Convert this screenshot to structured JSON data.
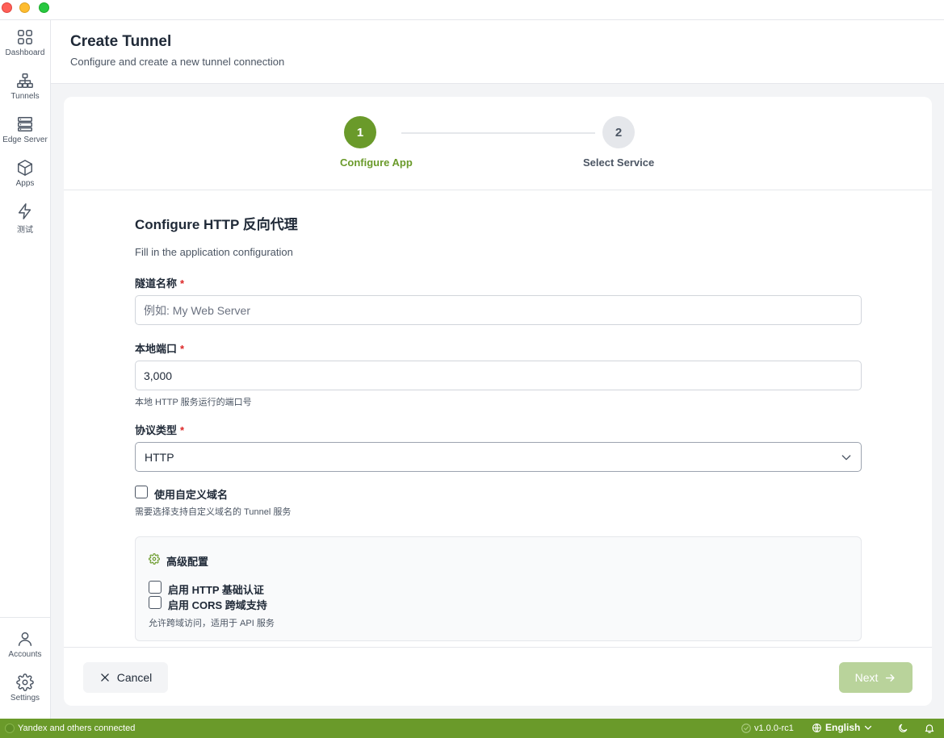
{
  "sidebar": {
    "items": [
      {
        "label": "Dashboard",
        "icon": "grid-icon"
      },
      {
        "label": "Tunnels",
        "icon": "network-icon"
      },
      {
        "label": "Edge Server",
        "icon": "server-icon"
      },
      {
        "label": "Apps",
        "icon": "cube-icon"
      },
      {
        "label": "测试",
        "icon": "bolt-icon"
      }
    ],
    "bottom": [
      {
        "label": "Accounts",
        "icon": "user-icon"
      },
      {
        "label": "Settings",
        "icon": "gear-icon"
      }
    ]
  },
  "header": {
    "title": "Create Tunnel",
    "subtitle": "Configure and create a new tunnel connection"
  },
  "stepper": {
    "steps": [
      {
        "number": "1",
        "label": "Configure App",
        "state": "active"
      },
      {
        "number": "2",
        "label": "Select Service",
        "state": "pending"
      }
    ]
  },
  "form": {
    "title": "Configure HTTP 反向代理",
    "description": "Fill in the application configuration",
    "tunnel_name": {
      "label": "隧道名称",
      "required": "*",
      "placeholder": "例如: My Web Server",
      "value": ""
    },
    "local_port": {
      "label": "本地端口",
      "required": "*",
      "value": "3,000",
      "hint": "本地 HTTP 服务运行的端口号"
    },
    "protocol": {
      "label": "协议类型",
      "required": "*",
      "value": "HTTP"
    },
    "custom_domain": {
      "label": "使用自定义域名",
      "checked": false,
      "hint": "需要选择支持自定义域名的 Tunnel 服务"
    },
    "advanced": {
      "title": "高级配置",
      "basic_auth": {
        "label": "启用 HTTP 基础认证",
        "checked": false
      },
      "cors": {
        "label": "启用 CORS 跨域支持",
        "checked": false,
        "hint": "允许跨域访问，适用于 API 服务"
      }
    }
  },
  "footer": {
    "cancel_label": "Cancel",
    "next_label": "Next"
  },
  "statusbar": {
    "connection_text": "Yandex and others connected",
    "version": "v1.0.0-rc1",
    "language": "English"
  },
  "colors": {
    "accent": "#6a9a2a",
    "accent_disabled": "#b9d39b",
    "required": "#dc2626"
  }
}
